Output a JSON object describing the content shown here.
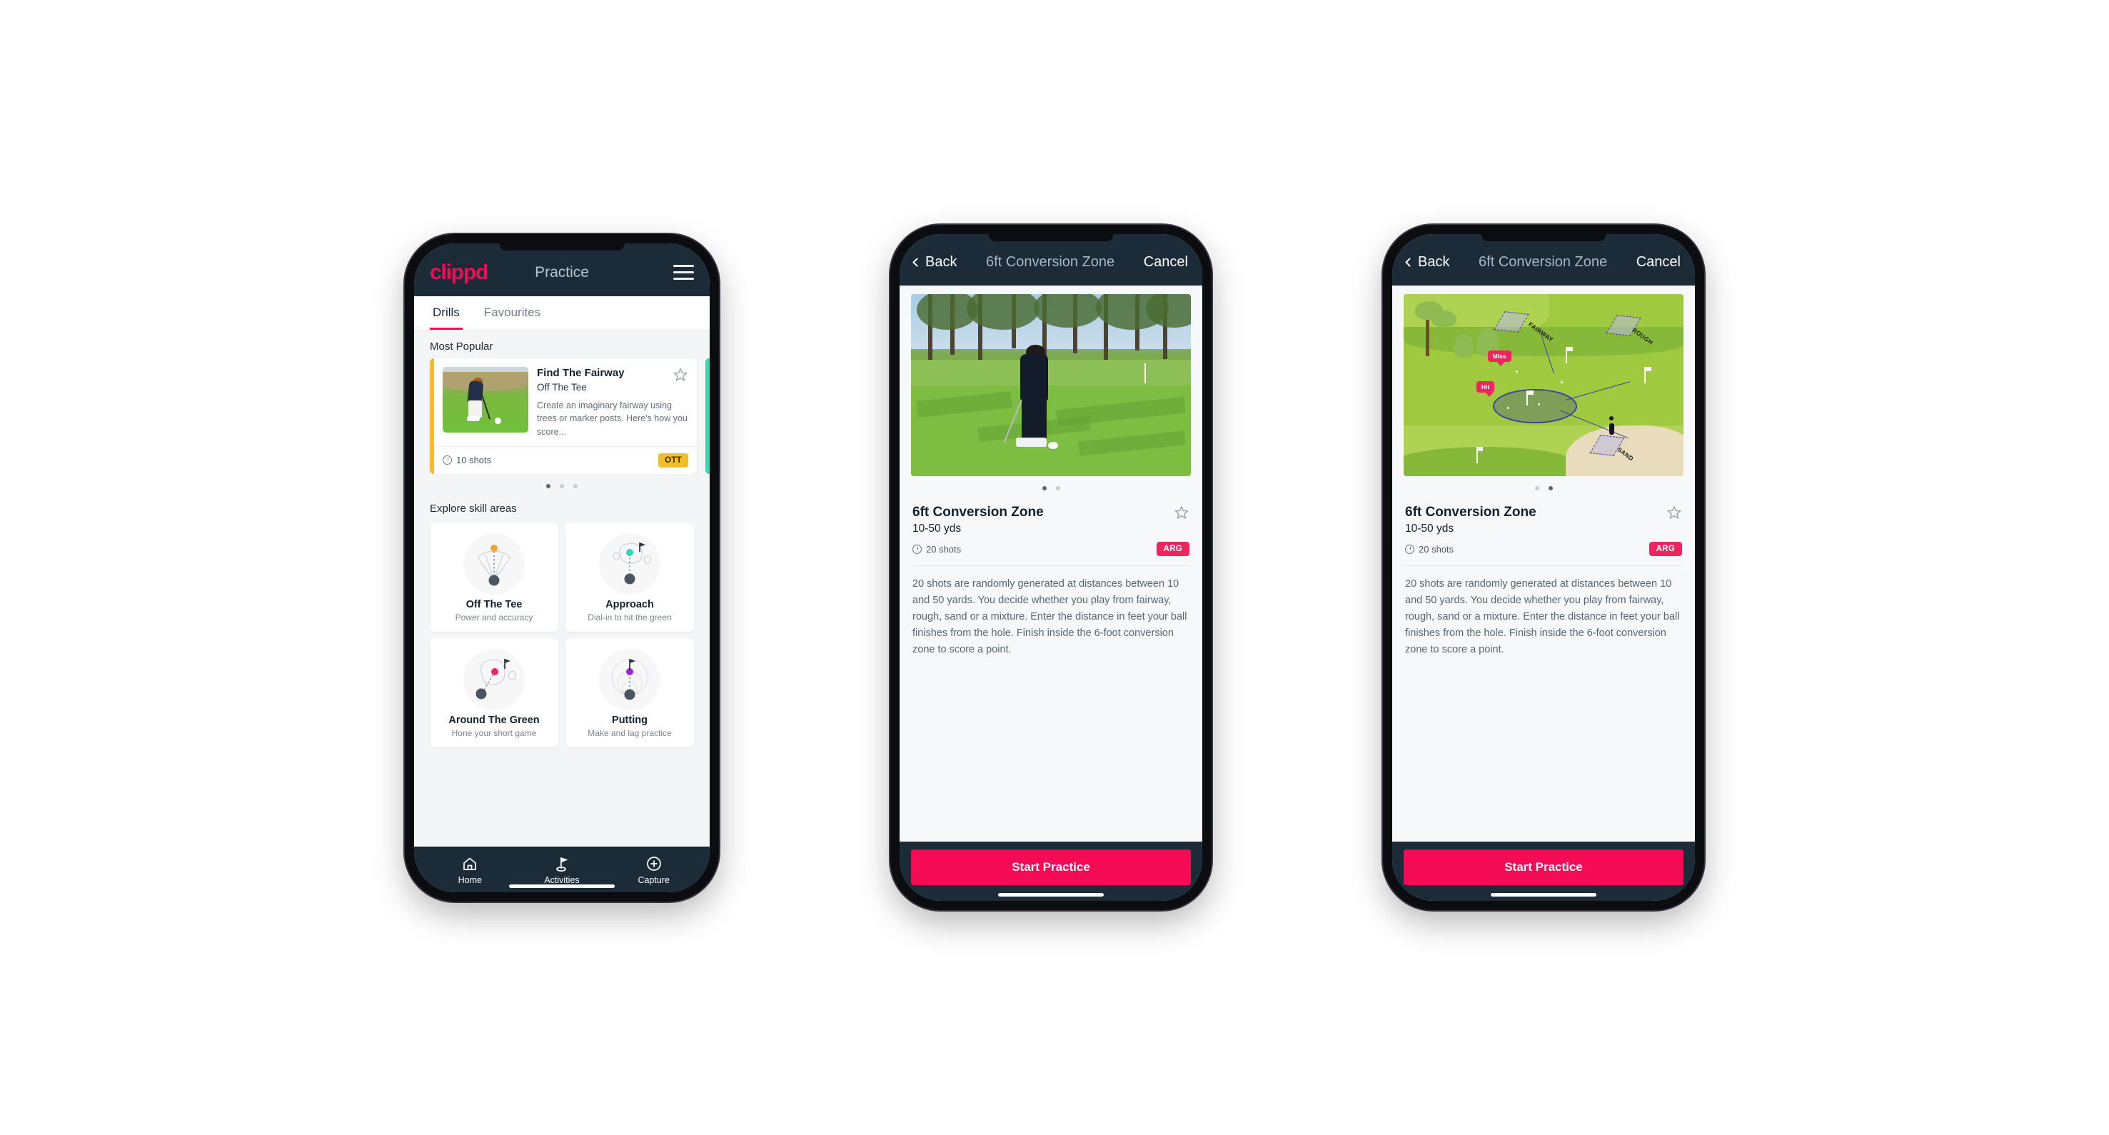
{
  "app": {
    "brand": "clippd",
    "accent": "#f50b55",
    "dark": "#1b2b38",
    "teal": "#3ed6b0",
    "amber": "#f5bc2a"
  },
  "phone1": {
    "header": {
      "logo": "clippd",
      "title": "Practice",
      "menu_icon": "hamburger-icon"
    },
    "tabs": [
      {
        "label": "Drills",
        "active": true
      },
      {
        "label": "Favourites",
        "active": false
      }
    ],
    "most_popular_label": "Most Popular",
    "drill_card": {
      "title": "Find The Fairway",
      "subtitle": "Off The Tee",
      "description": "Create an imaginary fairway using trees or marker posts. Here's how you score...",
      "shots": "10 shots",
      "badge": "OTT",
      "badge_color": "#f5bc2a",
      "accent_color": "#f5bc2a",
      "favourite": false
    },
    "carousel_dots": {
      "count": 3,
      "active_index": 0
    },
    "explore_label": "Explore skill areas",
    "skills": [
      {
        "name": "Off The Tee",
        "sub": "Power and accuracy",
        "icon": "tee-fan-icon",
        "dot_color": "#f5a623"
      },
      {
        "name": "Approach",
        "sub": "Dial-in to hit the green",
        "icon": "approach-green-icon",
        "dot_color": "#2fd6b0"
      },
      {
        "name": "Around The Green",
        "sub": "Hone your short game",
        "icon": "chip-green-icon",
        "dot_color": "#f0255f"
      },
      {
        "name": "Putting",
        "sub": "Make and lag practice",
        "icon": "putting-rings-icon",
        "dot_color": "#a424d6"
      }
    ],
    "bottom_nav": [
      {
        "label": "Home",
        "icon": "home-icon",
        "active": false
      },
      {
        "label": "Activities",
        "icon": "golf-flag-icon",
        "active": true
      },
      {
        "label": "Capture",
        "icon": "plus-circle-icon",
        "active": false
      }
    ]
  },
  "phone2": {
    "nav": {
      "back": "Back",
      "title": "6ft Conversion Zone",
      "cancel": "Cancel"
    },
    "media": {
      "type": "photo",
      "alt": "golfer chipping on fairway surrounded by pine trees"
    },
    "carousel_dots": {
      "count": 2,
      "active_index": 0
    },
    "detail": {
      "title": "6ft Conversion Zone",
      "yards": "10-50 yds",
      "shots": "20 shots",
      "badge": "ARG",
      "badge_color": "#f0255f",
      "favourite": false,
      "description": "20 shots are randomly generated at distances between 10 and 50 yards. You decide whether you play from fairway, rough, sand or a mixture. Enter the distance in feet your ball finishes from the hole. Finish inside the 6-foot conversion zone to score a point."
    },
    "cta": "Start Practice"
  },
  "phone3": {
    "nav": {
      "back": "Back",
      "title": "6ft Conversion Zone",
      "cancel": "Cancel"
    },
    "media": {
      "type": "illustration",
      "alt": "golf course diagram showing shot zones",
      "zone_labels": [
        "FAIRWAY",
        "ROUGH",
        "SAND"
      ],
      "markers": [
        {
          "label": "Miss",
          "color": "#f0255f"
        },
        {
          "label": "Hit",
          "color": "#f0255f"
        }
      ]
    },
    "carousel_dots": {
      "count": 2,
      "active_index": 1
    },
    "detail": {
      "title": "6ft Conversion Zone",
      "yards": "10-50 yds",
      "shots": "20 shots",
      "badge": "ARG",
      "badge_color": "#f0255f",
      "favourite": false,
      "description": "20 shots are randomly generated at distances between 10 and 50 yards. You decide whether you play from fairway, rough, sand or a mixture. Enter the distance in feet your ball finishes from the hole. Finish inside the 6-foot conversion zone to score a point."
    },
    "cta": "Start Practice"
  }
}
